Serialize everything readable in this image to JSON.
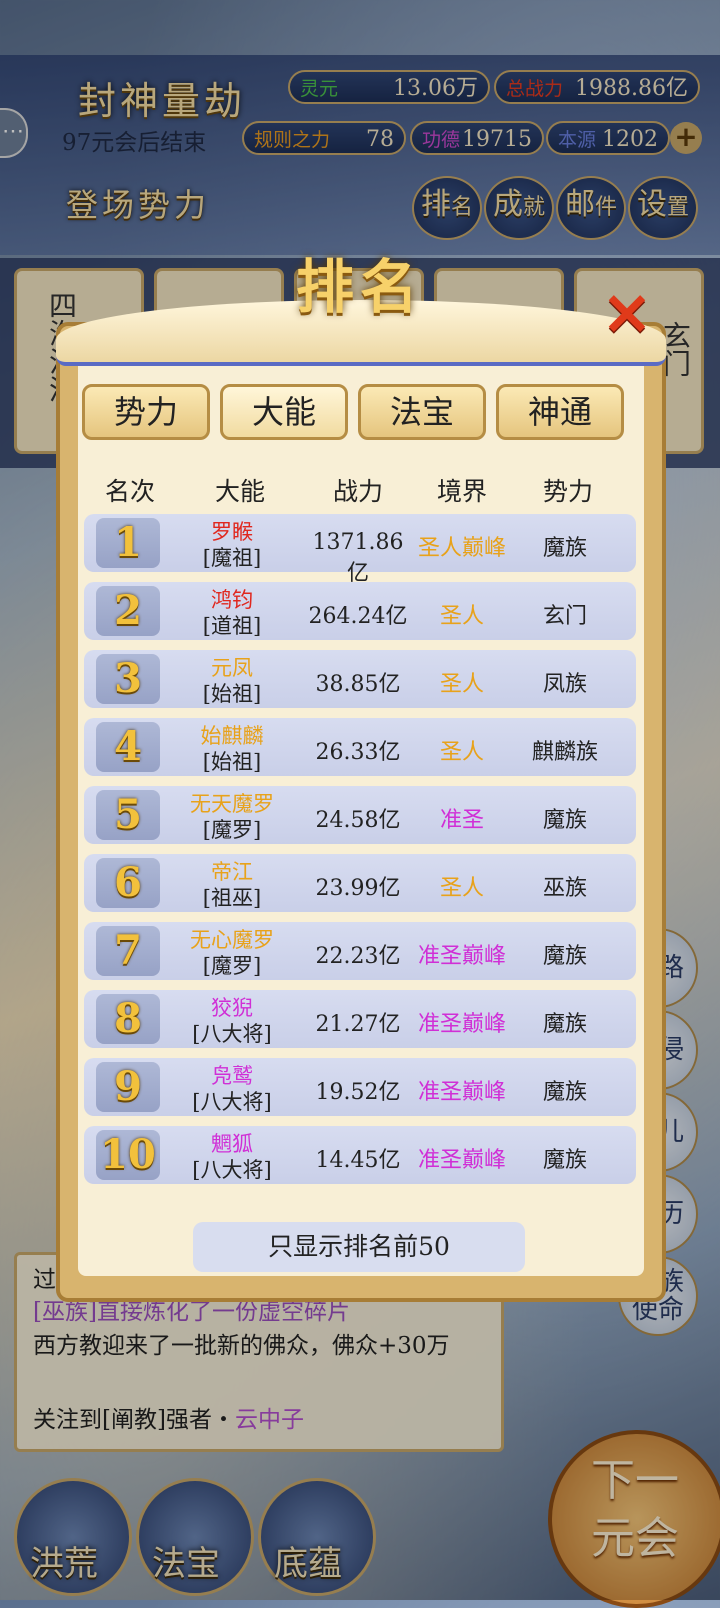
{
  "hud": {
    "event_title": "封神量劫",
    "countdown": "97元会后结束",
    "stats": [
      {
        "label": "灵元",
        "value": "13.06万"
      },
      {
        "label": "总战力",
        "value": "1988.86亿"
      },
      {
        "label": "规则之力",
        "value": "78"
      },
      {
        "label": "功德",
        "value": "19715"
      },
      {
        "label": "本源",
        "value": "1202"
      }
    ],
    "left_button": "登场势力",
    "buttons": [
      {
        "a": "排",
        "b": "名"
      },
      {
        "a": "成",
        "b": "就"
      },
      {
        "a": "邮",
        "b": "件"
      },
      {
        "a": "设",
        "b": "置"
      }
    ]
  },
  "background": {
    "faction_cards": [
      "四海沧洋",
      "玄门"
    ],
    "side_buttons": [
      "道路",
      "域侵",
      "道儿",
      "身历",
      "各族使命"
    ],
    "log_title": "过",
    "log_lines": [
      {
        "text": "[巫族]直接炼化了一份虚空碎片",
        "color": "#9b4fbf"
      },
      {
        "text": "西方教迎来了一批新的佛众，佛众+30万",
        "color": "#222222"
      },
      {
        "text_a": "关注到[阐教]强者・",
        "text_b": "云中子",
        "color_b": "#b44fd0"
      }
    ],
    "nav": [
      "洪荒",
      "法宝",
      "底蕴"
    ],
    "next_label_1": "下一",
    "next_label_2": "元会"
  },
  "modal": {
    "title": "排名",
    "close_icon": "×",
    "tabs": [
      "势力",
      "大能",
      "法宝",
      "神通"
    ],
    "active_tab": 1,
    "columns": [
      "名次",
      "大能",
      "战力",
      "境界",
      "势力"
    ],
    "rows": [
      {
        "rank": "1",
        "name": "罗睺",
        "title": "[魔祖]",
        "power": "1371.86亿",
        "realm": "圣人巅峰",
        "faction": "魔族",
        "name_color": "#e0271e",
        "realm_color": "#e8a21a"
      },
      {
        "rank": "2",
        "name": "鸿钧",
        "title": "[道祖]",
        "power": "264.24亿",
        "realm": "圣人",
        "faction": "玄门",
        "name_color": "#e0271e",
        "realm_color": "#e8a21a"
      },
      {
        "rank": "3",
        "name": "元凤",
        "title": "[始祖]",
        "power": "38.85亿",
        "realm": "圣人",
        "faction": "凤族",
        "name_color": "#e8a21a",
        "realm_color": "#e8a21a"
      },
      {
        "rank": "4",
        "name": "始麒麟",
        "title": "[始祖]",
        "power": "26.33亿",
        "realm": "圣人",
        "faction": "麒麟族",
        "name_color": "#e8a21a",
        "realm_color": "#e8a21a"
      },
      {
        "rank": "5",
        "name": "无天魔罗",
        "title": "[魔罗]",
        "power": "24.58亿",
        "realm": "准圣",
        "faction": "魔族",
        "name_color": "#e8a21a",
        "realm_color": "#d02fd6"
      },
      {
        "rank": "6",
        "name": "帝江",
        "title": "[祖巫]",
        "power": "23.99亿",
        "realm": "圣人",
        "faction": "巫族",
        "name_color": "#e8a21a",
        "realm_color": "#e8a21a"
      },
      {
        "rank": "7",
        "name": "无心魔罗",
        "title": "[魔罗]",
        "power": "22.23亿",
        "realm": "准圣巅峰",
        "faction": "魔族",
        "name_color": "#e8a21a",
        "realm_color": "#d02fd6"
      },
      {
        "rank": "8",
        "name": "狡猊",
        "title": "[八大将]",
        "power": "21.27亿",
        "realm": "准圣巅峰",
        "faction": "魔族",
        "name_color": "#d02fd6",
        "realm_color": "#d02fd6"
      },
      {
        "rank": "9",
        "name": "凫鹫",
        "title": "[八大将]",
        "power": "19.52亿",
        "realm": "准圣巅峰",
        "faction": "魔族",
        "name_color": "#d02fd6",
        "realm_color": "#d02fd6"
      },
      {
        "rank": "10",
        "name": "魍狐",
        "title": "[八大将]",
        "power": "14.45亿",
        "realm": "准圣巅峰",
        "faction": "魔族",
        "name_color": "#d02fd6",
        "realm_color": "#d02fd6"
      }
    ],
    "footer": "只显示排名前50"
  }
}
